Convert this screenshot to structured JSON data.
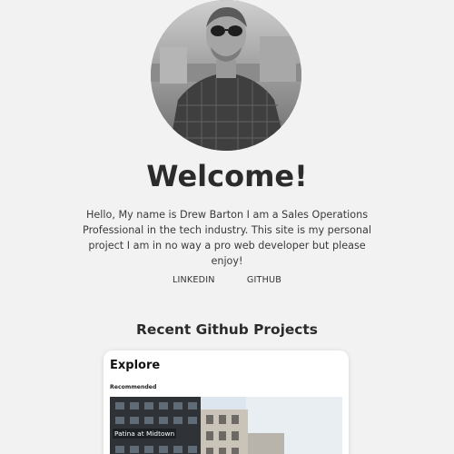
{
  "profile": {
    "avatar_alt": "Profile photo",
    "heading": "Welcome!",
    "intro": "Hello, My name is Drew Barton I am a Sales Operations Professional in the tech industry. This site is my personal project I am in no way a pro web developer but please enjoy!"
  },
  "links": {
    "linkedin": "LINKEDIN",
    "github": "GITHUB"
  },
  "projects": {
    "heading": "Recent Github Projects",
    "card": {
      "title": "Explore",
      "subtitle": "Recommended",
      "photo_label": "Patina at Midtown",
      "next_icon": "chevron-right-icon"
    }
  },
  "colors": {
    "background": "#f2f2f2",
    "text": "#333333",
    "accent": "#3b7dd8"
  }
}
